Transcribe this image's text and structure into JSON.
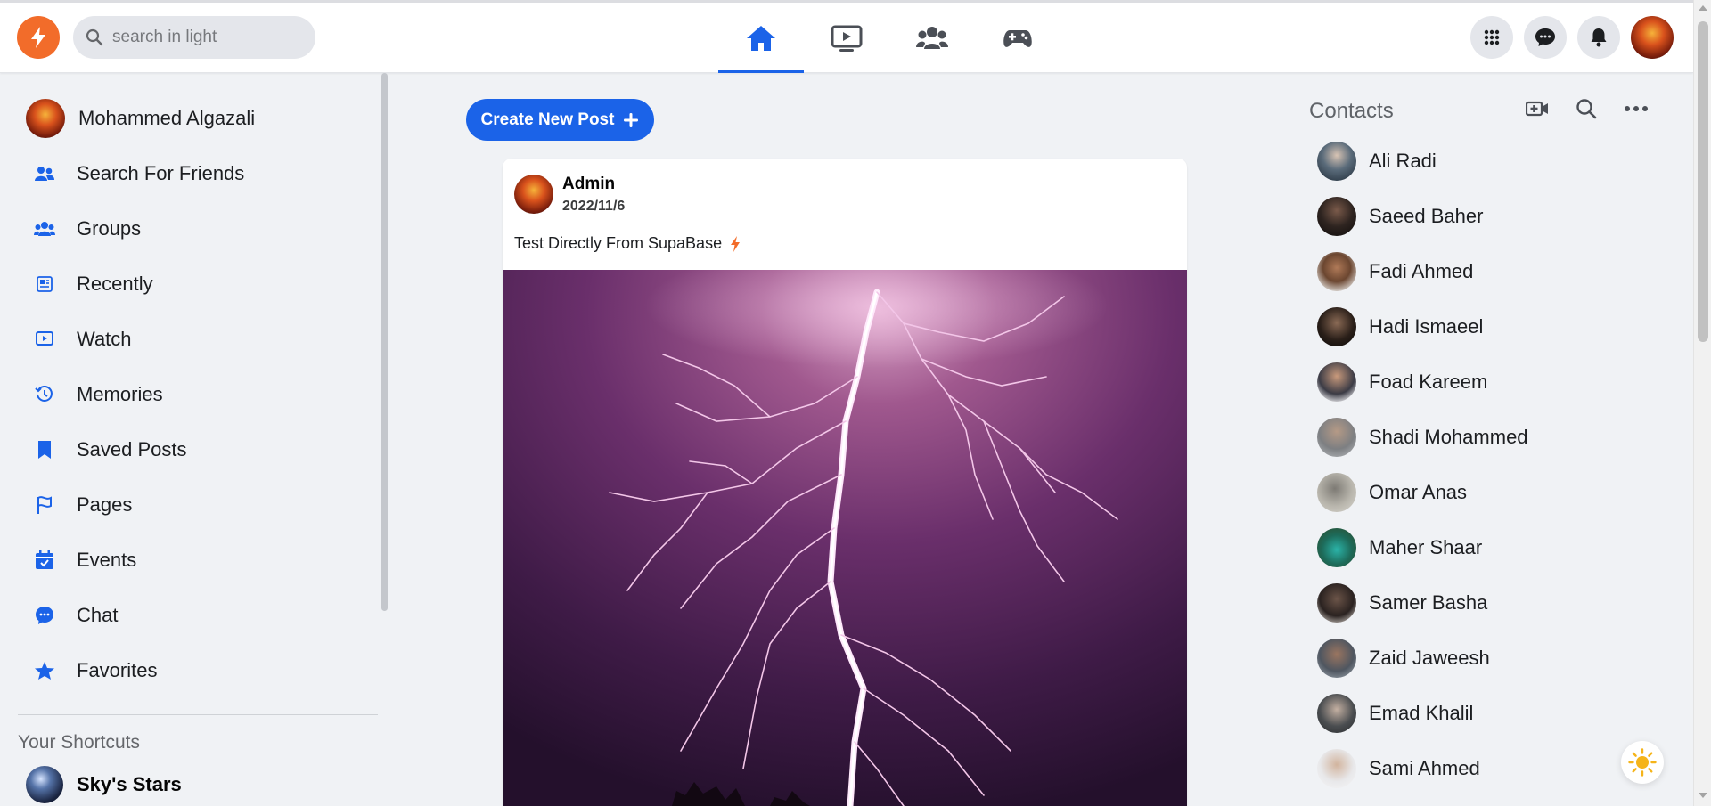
{
  "header": {
    "search_placeholder": "search in light",
    "nav_tabs": [
      {
        "name": "home",
        "icon": "home-icon",
        "active": true
      },
      {
        "name": "watch",
        "icon": "video-icon",
        "active": false
      },
      {
        "name": "groups",
        "icon": "group-icon",
        "active": false
      },
      {
        "name": "gaming",
        "icon": "gamepad-icon",
        "active": false
      }
    ],
    "actions": [
      "menu-grid-icon",
      "messenger-icon",
      "bell-icon",
      "profile-avatar"
    ]
  },
  "sidebar": {
    "items": [
      {
        "label": "Mohammed Algazali",
        "icon": "profile-avatar"
      },
      {
        "label": "Search For Friends",
        "icon": "friends-icon"
      },
      {
        "label": "Groups",
        "icon": "groups-icon"
      },
      {
        "label": "Recently",
        "icon": "news-icon"
      },
      {
        "label": "Watch",
        "icon": "watch-icon"
      },
      {
        "label": "Memories",
        "icon": "clock-icon"
      },
      {
        "label": "Saved Posts",
        "icon": "bookmark-icon"
      },
      {
        "label": "Pages",
        "icon": "flag-icon"
      },
      {
        "label": "Events",
        "icon": "calendar-icon"
      },
      {
        "label": "Chat",
        "icon": "chat-icon"
      },
      {
        "label": "Favorites",
        "icon": "star-icon"
      }
    ],
    "shortcuts_title": "Your Shortcuts",
    "shortcuts": [
      {
        "label": "Sky's Stars"
      }
    ]
  },
  "feed": {
    "create_label": "Create New Post",
    "post": {
      "author": "Admin",
      "date": "2022/11/6",
      "text": "Test Directly From SupaBase"
    }
  },
  "contacts": {
    "title": "Contacts",
    "items": [
      {
        "name": "Ali Radi"
      },
      {
        "name": "Saeed Baher"
      },
      {
        "name": "Fadi Ahmed"
      },
      {
        "name": "Hadi Ismaeel"
      },
      {
        "name": "Foad Kareem"
      },
      {
        "name": "Shadi Mohammed"
      },
      {
        "name": "Omar Anas"
      },
      {
        "name": "Maher Shaar"
      },
      {
        "name": "Samer Basha"
      },
      {
        "name": "Zaid Jaweesh"
      },
      {
        "name": "Emad Khalil"
      },
      {
        "name": "Sami Ahmed"
      }
    ]
  },
  "colors": {
    "accent": "#1b63e8",
    "logo": "#f26c2a",
    "background": "#f0f2f5",
    "muted": "#65676b"
  }
}
